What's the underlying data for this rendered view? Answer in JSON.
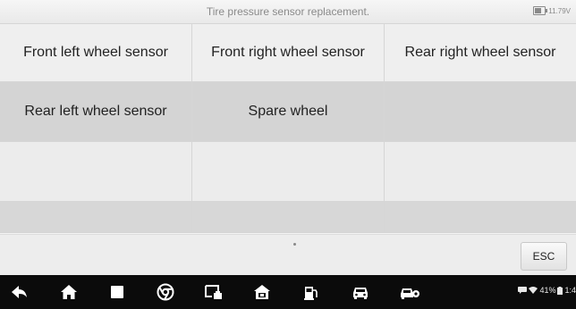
{
  "header": {
    "title": "Tire pressure sensor replacement.",
    "voltage": "11.79V"
  },
  "grid": {
    "rows": [
      [
        "Front left wheel sensor",
        "Front right wheel sensor",
        "Rear right wheel sensor"
      ],
      [
        "Rear left wheel sensor",
        "Spare wheel",
        ""
      ],
      [
        "",
        "",
        ""
      ],
      [
        "",
        "",
        ""
      ]
    ]
  },
  "actions": {
    "esc_label": "ESC"
  },
  "navbar": {
    "icons": [
      "back-icon",
      "home-icon",
      "recent-apps-icon",
      "chrome-icon",
      "screen-connect-icon",
      "vci-home-icon",
      "fuel-icon",
      "car-icon",
      "car-service-icon"
    ],
    "status_text": "41%",
    "clock": "1:4"
  },
  "colors": {
    "background": "#f4f4f4",
    "row_light": "#efefef",
    "row_dark": "#d4d4d4",
    "navbar": "#0b0b0b"
  }
}
